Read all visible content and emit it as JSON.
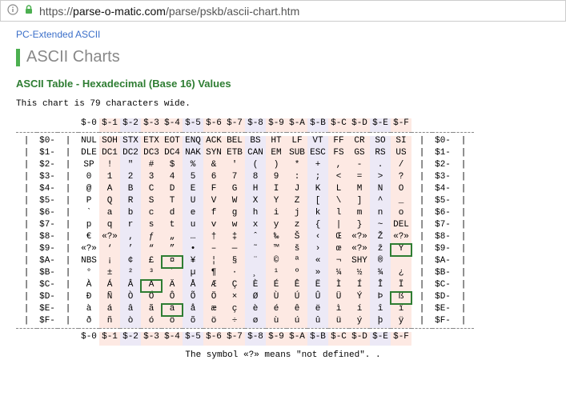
{
  "address_bar": {
    "url_prefix": "https://",
    "url_host": "parse-o-matic.com",
    "url_path": "/parse/pskb/ascii-chart.htm"
  },
  "ext_link": "PC-Extended ASCII",
  "heading": "ASCII Charts",
  "subheading": "ASCII Table - Hexadecimal (Base 16) Values",
  "width_note": "This chart is 79 characters wide.",
  "footnote": "The symbol «?» means \"not defined\". .",
  "sep_char": "|",
  "cols": [
    "$-0",
    "$-1",
    "$-2",
    "$-3",
    "$-4",
    "$-5",
    "$-6",
    "$-7",
    "$-8",
    "$-9",
    "$-A",
    "$-B",
    "$-C",
    "$-D",
    "$-E",
    "$-F"
  ],
  "row_labels": [
    "$0-",
    "$1-",
    "$2-",
    "$3-",
    "$4-",
    "$5-",
    "$6-",
    "$7-",
    "$8-",
    "$9-",
    "$A-",
    "$B-",
    "$C-",
    "$D-",
    "$E-",
    "$F-"
  ],
  "cells": [
    [
      "NUL",
      "SOH",
      "STX",
      "ETX",
      "EOT",
      "ENQ",
      "ACK",
      "BEL",
      "BS",
      "HT",
      "LF",
      "VT",
      "FF",
      "CR",
      "SO",
      "SI"
    ],
    [
      "DLE",
      "DC1",
      "DC2",
      "DC3",
      "DC4",
      "NAK",
      "SYN",
      "ETB",
      "CAN",
      "EM",
      "SUB",
      "ESC",
      "FS",
      "GS",
      "RS",
      "US"
    ],
    [
      "SP",
      "!",
      "\"",
      "#",
      "$",
      "%",
      "&",
      "'",
      "(",
      ")",
      "*",
      "+",
      ",",
      "-",
      ".",
      "/"
    ],
    [
      "0",
      "1",
      "2",
      "3",
      "4",
      "5",
      "6",
      "7",
      "8",
      "9",
      ":",
      ";",
      "<",
      "=",
      ">",
      "?"
    ],
    [
      "@",
      "A",
      "B",
      "C",
      "D",
      "E",
      "F",
      "G",
      "H",
      "I",
      "J",
      "K",
      "L",
      "M",
      "N",
      "O"
    ],
    [
      "P",
      "Q",
      "R",
      "S",
      "T",
      "U",
      "V",
      "W",
      "X",
      "Y",
      "Z",
      "[",
      "\\",
      "]",
      "^",
      "_"
    ],
    [
      "`",
      "a",
      "b",
      "c",
      "d",
      "e",
      "f",
      "g",
      "h",
      "i",
      "j",
      "k",
      "l",
      "m",
      "n",
      "o"
    ],
    [
      "p",
      "q",
      "r",
      "s",
      "t",
      "u",
      "v",
      "w",
      "x",
      "y",
      "z",
      "{",
      "|",
      "}",
      "~",
      "DEL"
    ],
    [
      "€",
      "«?»",
      "‚",
      "ƒ",
      "„",
      "…",
      "†",
      "‡",
      "ˆ",
      "‰",
      "Š",
      "‹",
      "Œ",
      "«?»",
      "Ž",
      "«?»"
    ],
    [
      "«?»",
      "‘",
      "’",
      "“",
      "”",
      "•",
      "–",
      "—",
      "˜",
      "™",
      "š",
      "›",
      "œ",
      "«?»",
      "ž",
      "Ÿ"
    ],
    [
      "NBS",
      "¡",
      "¢",
      "£",
      "¤",
      "¥",
      "¦",
      "§",
      "¨",
      "©",
      "ª",
      "«",
      "¬",
      "SHY",
      "®",
      "¯"
    ],
    [
      "°",
      "±",
      "²",
      "³",
      "´",
      "µ",
      "¶",
      "·",
      "¸",
      "¹",
      "º",
      "»",
      "¼",
      "½",
      "¾",
      "¿"
    ],
    [
      "À",
      "Á",
      "Â",
      "Ã",
      "Ä",
      "Å",
      "Æ",
      "Ç",
      "È",
      "É",
      "Ê",
      "Ë",
      "Ì",
      "Í",
      "Î",
      "Ï"
    ],
    [
      "Ð",
      "Ñ",
      "Ò",
      "Ó",
      "Ô",
      "Õ",
      "Ö",
      "×",
      "Ø",
      "Ù",
      "Ú",
      "Û",
      "Ü",
      "Ý",
      "Þ",
      "ß"
    ],
    [
      "à",
      "á",
      "â",
      "ã",
      "ä",
      "å",
      "æ",
      "ç",
      "è",
      "é",
      "ê",
      "ë",
      "ì",
      "í",
      "î",
      "ï"
    ],
    [
      "ð",
      "ñ",
      "ò",
      "ó",
      "ô",
      "õ",
      "ö",
      "÷",
      "ø",
      "ù",
      "ú",
      "û",
      "ü",
      "ý",
      "þ",
      "ÿ"
    ]
  ],
  "highlights": [
    [
      9,
      15
    ],
    [
      10,
      4
    ],
    [
      12,
      3
    ],
    [
      13,
      15
    ],
    [
      14,
      4
    ]
  ],
  "colors": {
    "accent": "#2e7d32",
    "tint1": "#fde9e3",
    "tint2": "#ece9f6"
  }
}
